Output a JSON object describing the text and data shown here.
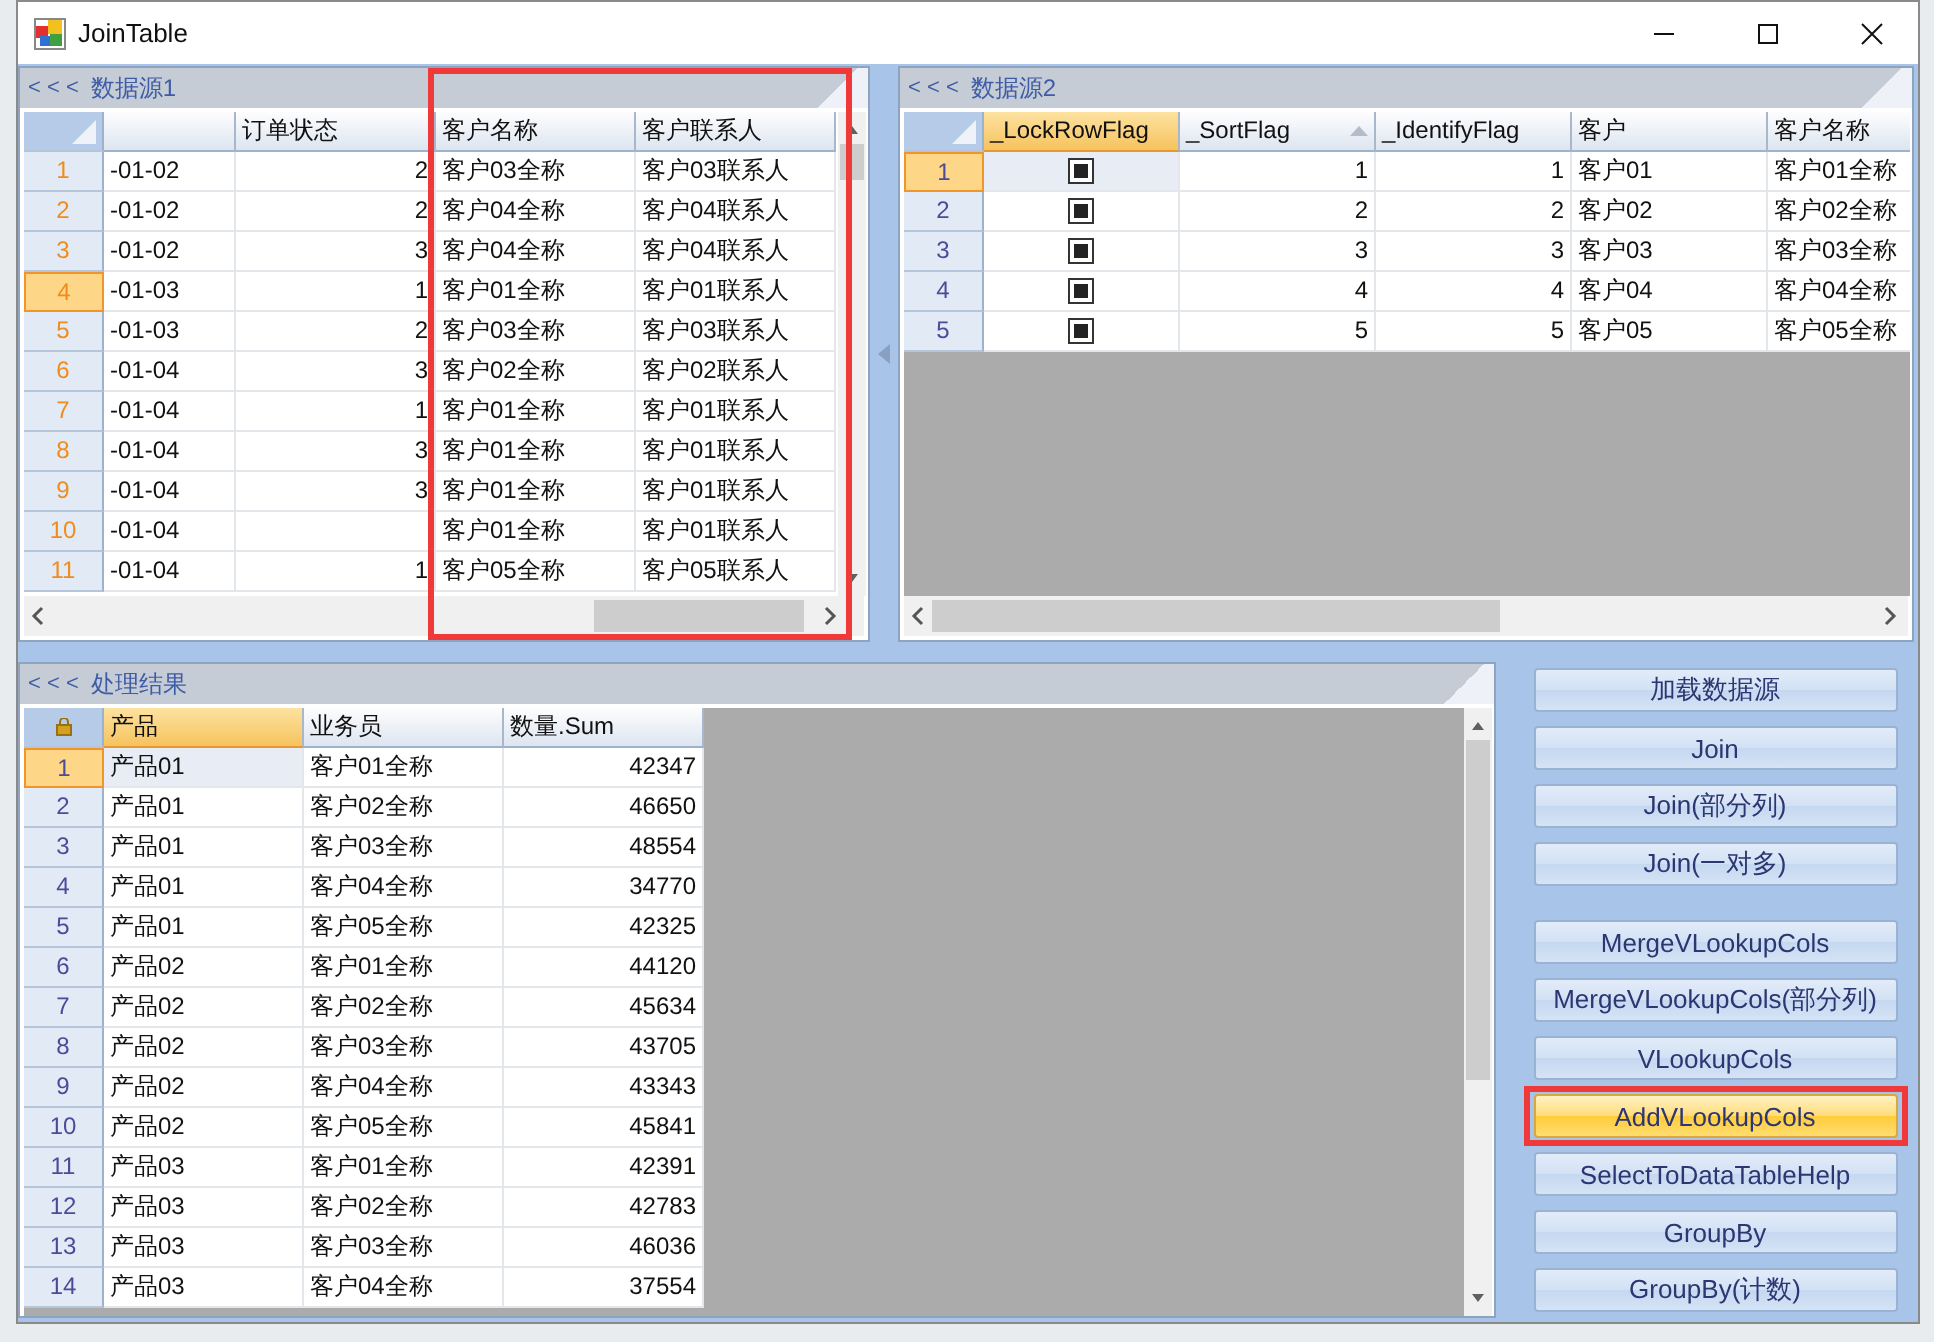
{
  "window": {
    "title": "JoinTable"
  },
  "panels": [
    {
      "collapse_glyph": "< < <",
      "title": "数据源1",
      "columns": [
        {
          "kind": "text",
          "selected": false
        },
        {
          "label": "订单状态",
          "kind": "number",
          "selected": false
        },
        {
          "label": "客户名称",
          "kind": "text",
          "selected": false,
          "annotated": true
        },
        {
          "label": "客户联系人",
          "kind": "text",
          "selected": false,
          "annotated": true
        }
      ],
      "rows": [
        {
          "number": "1",
          "selected": false,
          "cells": [
            "-01-02",
            "2",
            "客户03全称",
            "客户03联系人"
          ]
        },
        {
          "number": "2",
          "selected": false,
          "cells": [
            "-01-02",
            "2",
            "客户04全称",
            "客户04联系人"
          ]
        },
        {
          "number": "3",
          "selected": false,
          "cells": [
            "-01-02",
            "3",
            "客户04全称",
            "客户04联系人"
          ]
        },
        {
          "number": "4",
          "selected": true,
          "cells": [
            "-01-03",
            "1",
            "客户01全称",
            "客户01联系人"
          ]
        },
        {
          "number": "5",
          "selected": false,
          "cells": [
            "-01-03",
            "2",
            "客户03全称",
            "客户03联系人"
          ]
        },
        {
          "number": "6",
          "selected": false,
          "cells": [
            "-01-04",
            "3",
            "客户02全称",
            "客户02联系人"
          ]
        },
        {
          "number": "7",
          "selected": false,
          "cells": [
            "-01-04",
            "1",
            "客户01全称",
            "客户01联系人"
          ]
        },
        {
          "number": "8",
          "selected": false,
          "cells": [
            "-01-04",
            "3",
            "客户01全称",
            "客户01联系人"
          ]
        },
        {
          "number": "9",
          "selected": false,
          "cells": [
            "-01-04",
            "3",
            "客户01全称",
            "客户01联系人"
          ]
        },
        {
          "number": "10",
          "selected": false,
          "cells": [
            "-01-04",
            "",
            "客户01全称",
            "客户01联系人"
          ]
        },
        {
          "number": "11",
          "selected": false,
          "cells": [
            "-01-04",
            "1",
            "客户05全称",
            "客户05联系人"
          ]
        }
      ]
    },
    {
      "collapse_glyph": "< < <",
      "title": "数据源2",
      "columns": [
        {
          "label": "_LockRowFlag",
          "kind": "checkbox",
          "selected": true
        },
        {
          "label": "_SortFlag",
          "kind": "number",
          "selected": false,
          "sort_ascending": true
        },
        {
          "label": "_IdentifyFlag",
          "kind": "number",
          "selected": false
        },
        {
          "label": "客户",
          "kind": "text",
          "selected": false
        },
        {
          "label": "客户名称",
          "kind": "text",
          "selected": false
        }
      ],
      "rows": [
        {
          "number": "1",
          "selected": true,
          "cells": [
            true,
            "1",
            "1",
            "客户01",
            "客户01全称"
          ]
        },
        {
          "number": "2",
          "selected": false,
          "cells": [
            true,
            "2",
            "2",
            "客户02",
            "客户02全称"
          ]
        },
        {
          "number": "3",
          "selected": false,
          "cells": [
            true,
            "3",
            "3",
            "客户03",
            "客户03全称"
          ]
        },
        {
          "number": "4",
          "selected": false,
          "cells": [
            true,
            "4",
            "4",
            "客户04",
            "客户04全称"
          ]
        },
        {
          "number": "5",
          "selected": false,
          "cells": [
            true,
            "5",
            "5",
            "客户05",
            "客户05全称"
          ]
        }
      ]
    },
    {
      "collapse_glyph": "< < <",
      "title": "处理结果",
      "columns": [
        {
          "label": "产品",
          "kind": "text",
          "selected": true
        },
        {
          "label": "业务员",
          "kind": "text",
          "selected": false
        },
        {
          "label": "数量.Sum",
          "kind": "number",
          "selected": false
        }
      ],
      "rows": [
        {
          "number": "1",
          "selected": true,
          "cells": [
            "产品01",
            "客户01全称",
            "42347"
          ]
        },
        {
          "number": "2",
          "selected": false,
          "cells": [
            "产品01",
            "客户02全称",
            "46650"
          ]
        },
        {
          "number": "3",
          "selected": false,
          "cells": [
            "产品01",
            "客户03全称",
            "48554"
          ]
        },
        {
          "number": "4",
          "selected": false,
          "cells": [
            "产品01",
            "客户04全称",
            "34770"
          ]
        },
        {
          "number": "5",
          "selected": false,
          "cells": [
            "产品01",
            "客户05全称",
            "42325"
          ]
        },
        {
          "number": "6",
          "selected": false,
          "cells": [
            "产品02",
            "客户01全称",
            "44120"
          ]
        },
        {
          "number": "7",
          "selected": false,
          "cells": [
            "产品02",
            "客户02全称",
            "45634"
          ]
        },
        {
          "number": "8",
          "selected": false,
          "cells": [
            "产品02",
            "客户03全称",
            "43705"
          ]
        },
        {
          "number": "9",
          "selected": false,
          "cells": [
            "产品02",
            "客户04全称",
            "43343"
          ]
        },
        {
          "number": "10",
          "selected": false,
          "cells": [
            "产品02",
            "客户05全称",
            "45841"
          ]
        },
        {
          "number": "11",
          "selected": false,
          "cells": [
            "产品03",
            "客户01全称",
            "42391"
          ]
        },
        {
          "number": "12",
          "selected": false,
          "cells": [
            "产品03",
            "客户02全称",
            "42783"
          ]
        },
        {
          "number": "13",
          "selected": false,
          "cells": [
            "产品03",
            "客户03全称",
            "46036"
          ]
        },
        {
          "number": "14",
          "selected": false,
          "cells": [
            "产品03",
            "客户04全称",
            "37554"
          ]
        }
      ]
    }
  ],
  "button_groups": [
    [
      {
        "label": "加载数据源",
        "selected": false
      },
      {
        "label": "Join",
        "selected": false
      },
      {
        "label": "Join(部分列)",
        "selected": false
      },
      {
        "label": "Join(一对多)",
        "selected": false
      }
    ],
    [
      {
        "label": "MergeVLookupCols",
        "selected": false
      },
      {
        "label": "MergeVLookupCols(部分列)",
        "selected": false
      },
      {
        "label": "VLookupCols",
        "selected": false
      },
      {
        "label": "AddVLookupCols",
        "selected": true,
        "annotated": true
      },
      {
        "label": "SelectToDataTableHelp",
        "selected": false
      },
      {
        "label": "GroupBy",
        "selected": false
      },
      {
        "label": "GroupBy(计数)",
        "selected": false
      }
    ]
  ]
}
